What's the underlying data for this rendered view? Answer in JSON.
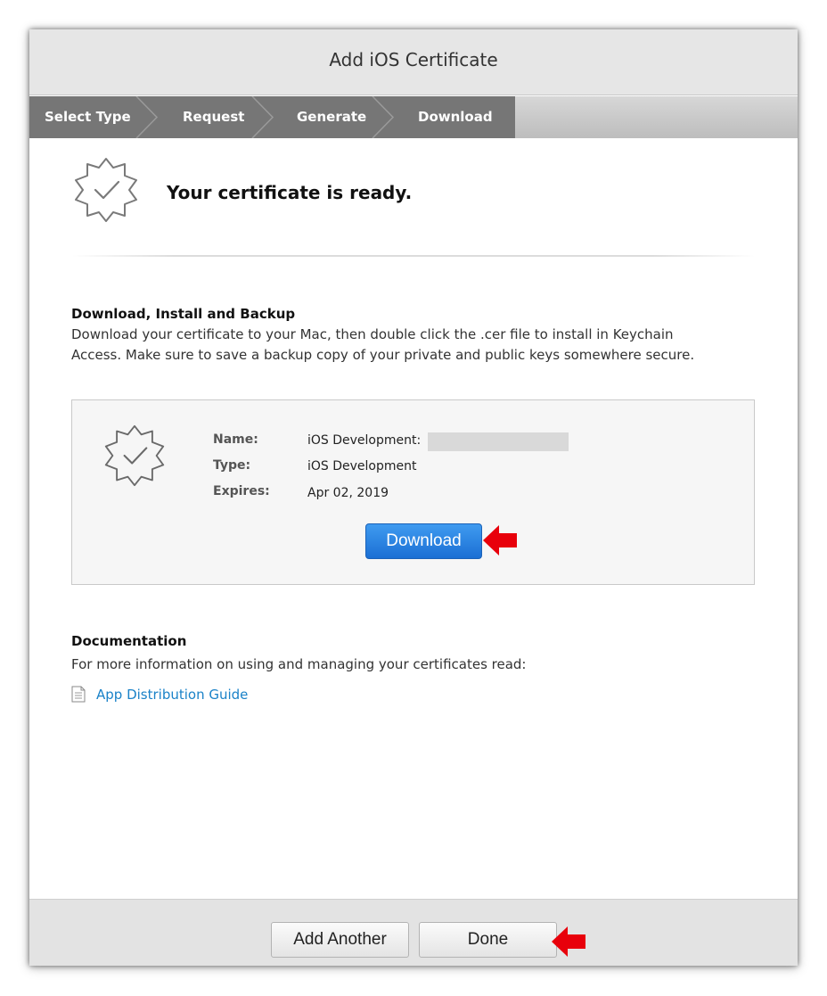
{
  "window": {
    "title": "Add iOS Certificate"
  },
  "steps": [
    {
      "label": "Select Type"
    },
    {
      "label": "Request"
    },
    {
      "label": "Generate"
    },
    {
      "label": "Download"
    }
  ],
  "status": {
    "message": "Your certificate is ready.",
    "icon": "certificate-badge-icon"
  },
  "download_section": {
    "heading": "Download, Install and Backup",
    "line1": "Download your certificate to your Mac, then double click the .cer file to install in Keychain",
    "line2": "Access. Make sure to save a backup copy of your private and public keys somewhere secure."
  },
  "certificate": {
    "name_label": "Name:",
    "name_value": "iOS Development:",
    "type_label": "Type:",
    "type_value": "iOS Development",
    "expires_label": "Expires:",
    "expires_value": "Apr 02, 2019",
    "download_button": "Download"
  },
  "documentation": {
    "heading": "Documentation",
    "text": "For more information on using and managing your certificates read:",
    "link": "App Distribution Guide"
  },
  "footer": {
    "add_another": "Add Another",
    "done": "Done"
  },
  "colors": {
    "accent_blue": "#1b6fd4",
    "link_blue": "#1a82c8",
    "annotation_red": "#e8000b",
    "active_step": "#767676"
  }
}
